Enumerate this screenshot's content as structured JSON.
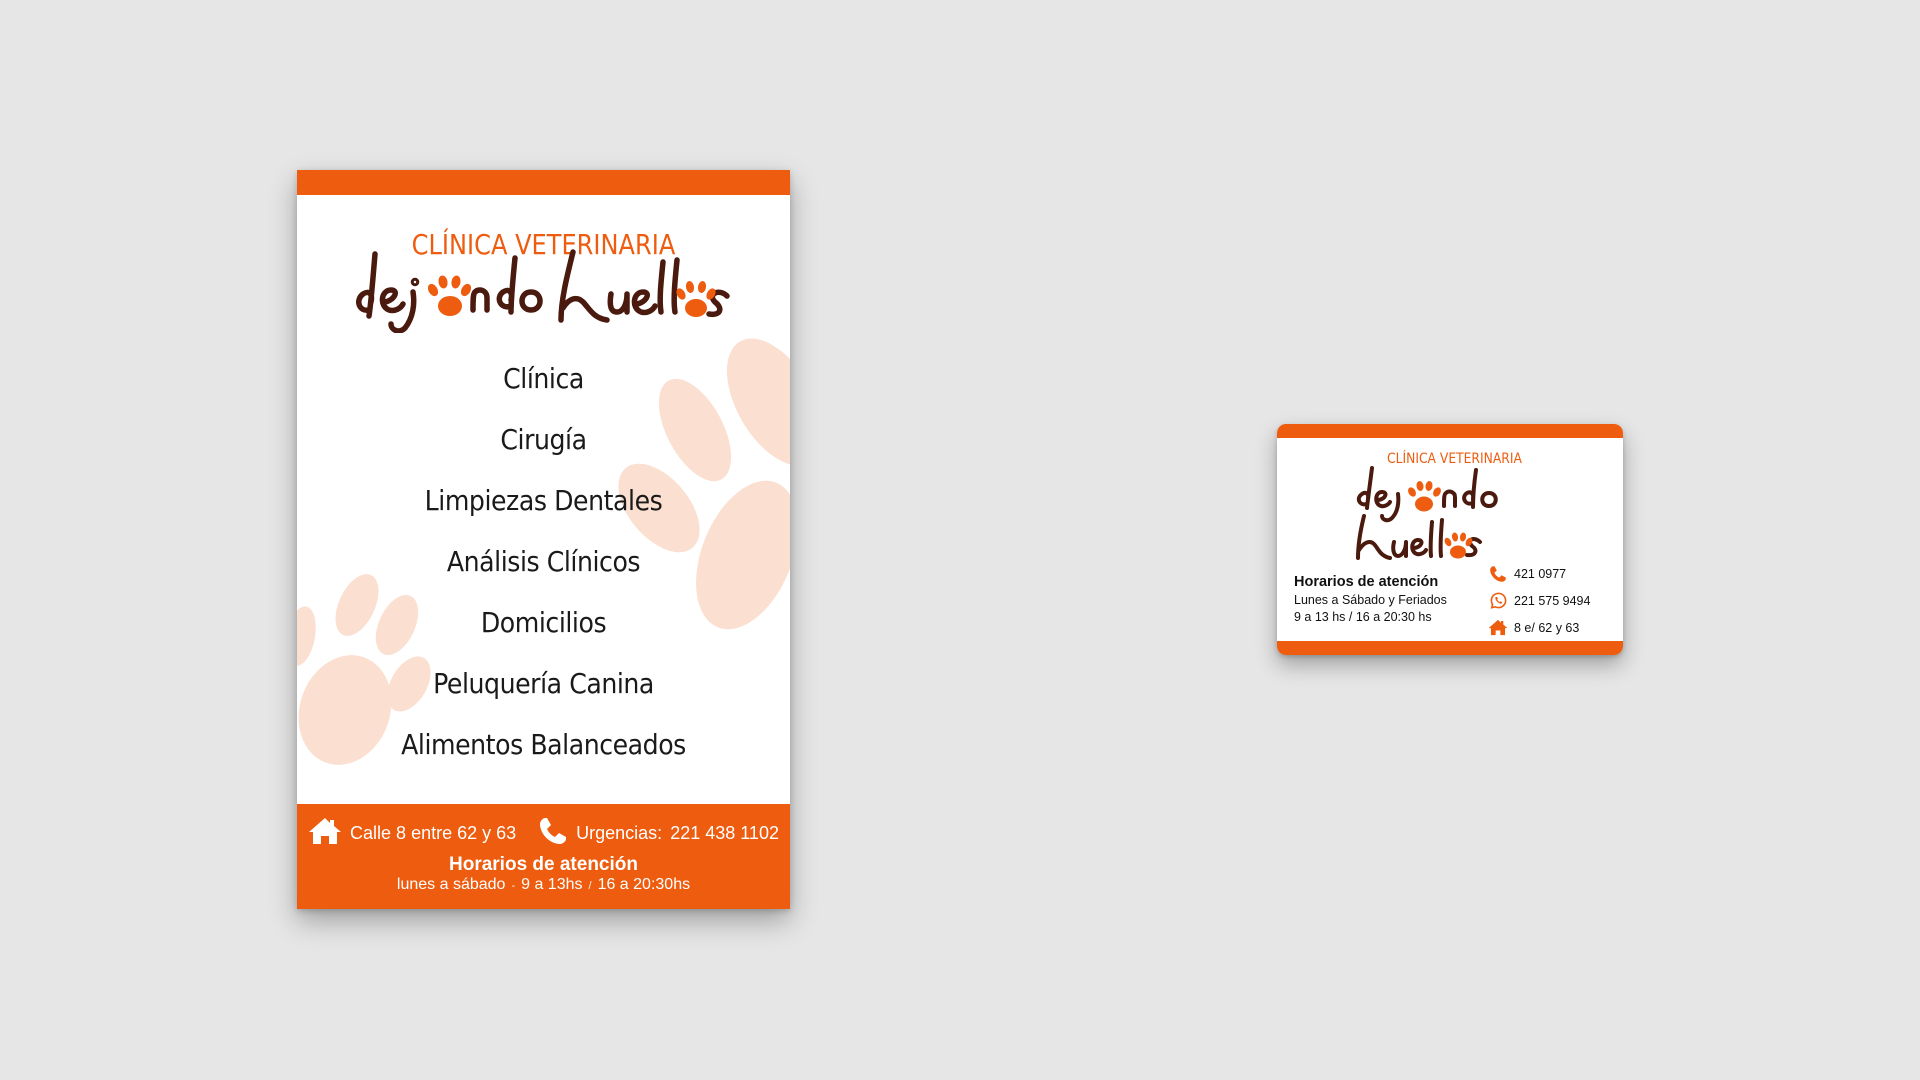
{
  "colors": {
    "accent": "#ed5c0f",
    "brown": "#4a1a0e",
    "paw_light": "#fbdfd0",
    "background": "#e6e6e6",
    "white": "#ffffff"
  },
  "flyer": {
    "header_title": "CLÍNICA VETERINARIA",
    "logo_text": "dejando huellas",
    "logo_icon": "paw-print-icon",
    "services": [
      "Clínica",
      "Cirugía",
      "Limpiezas Dentales",
      "Análisis Clínicos",
      "Domicilios",
      "Peluquería Canina",
      "Alimentos Balanceados"
    ],
    "footer": {
      "address_icon": "home-icon",
      "address": "Calle 8 entre 62 y 63",
      "phone_icon": "phone-icon",
      "emergency_label": "Urgencias:",
      "emergency_phone": "221 438 1102",
      "hours_title": "Horarios de atención",
      "hours_days": "lunes a sábado",
      "hours_sep": "-",
      "hours_morning": "9 a 13hs",
      "hours_slash": "/",
      "hours_afternoon": "16 a 20:30hs"
    }
  },
  "card": {
    "title": "CLÍNICA VETERINARIA",
    "logo_text": "dejando huellas",
    "hours_title": "Horarios de atención",
    "hours_days": "Lunes a Sábado y Feriados",
    "hours_times": "9 a 13 hs / 16 a 20:30 hs",
    "contacts": [
      {
        "icon": "phone-icon",
        "text": "421 0977"
      },
      {
        "icon": "whatsapp-icon",
        "text": "221 575 9494"
      },
      {
        "icon": "home-icon",
        "text": "8 e/ 62 y 63"
      }
    ]
  }
}
